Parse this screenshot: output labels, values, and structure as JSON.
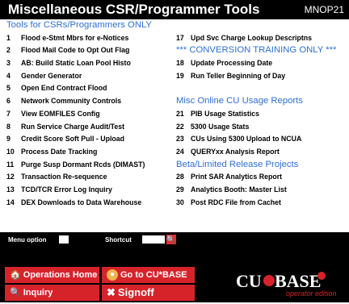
{
  "app": {
    "title": "Miscellaneous CSR/Programmer Tools",
    "code": "MNOP21"
  },
  "left_column": [
    {
      "type": "header",
      "label": "Tools for CSRs/Programmers ONLY"
    },
    {
      "num": "1",
      "label": "Flood e-Stmt Mbrs for e-Notices"
    },
    {
      "num": "2",
      "label": "Flood Mail Code to Opt Out Flag"
    },
    {
      "num": "3",
      "label": "AB: Build Static Loan Pool Histo"
    },
    {
      "num": "4",
      "label": "Gender Generator"
    },
    {
      "num": "5",
      "label": "Open End Contract Flood"
    },
    {
      "num": "6",
      "label": "Network Community Controls"
    },
    {
      "num": "7",
      "label": "View EOMFILES Config"
    },
    {
      "num": "8",
      "label": "Run Service Charge Audit/Test"
    },
    {
      "num": "9",
      "label": "Credit Score Soft Pull - Upload"
    },
    {
      "num": "10",
      "label": "Process Date Tracking"
    },
    {
      "num": "11",
      "label": "Purge Susp Dormant Rcds (DIMAST)"
    },
    {
      "num": "12",
      "label": "Transaction Re-sequence"
    },
    {
      "num": "13",
      "label": "TCD/TCR Error Log Inquiry"
    },
    {
      "num": "14",
      "label": "DEX Downloads to Data Warehouse"
    }
  ],
  "right_column": [
    {
      "type": "blank"
    },
    {
      "num": "17",
      "label": "Upd Svc Charge Lookup Descriptns"
    },
    {
      "type": "header",
      "label": "*** CONVERSION TRAINING ONLY ***"
    },
    {
      "num": "18",
      "label": "Update Processing Date"
    },
    {
      "num": "19",
      "label": "Run Teller Beginning of Day"
    },
    {
      "type": "blank"
    },
    {
      "type": "header",
      "label": "Misc Online CU Usage Reports"
    },
    {
      "num": "21",
      "label": "PIB Usage Statistics"
    },
    {
      "num": "22",
      "label": "5300 Usage Stats"
    },
    {
      "num": "23",
      "label": "CUs Using 5300 Upload to NCUA"
    },
    {
      "num": "24",
      "label": "QUERYxx Analysis Report"
    },
    {
      "type": "header",
      "label": "Beta/Limited Release Projects"
    },
    {
      "num": "28",
      "label": "Print SAR Analytics Report"
    },
    {
      "num": "29",
      "label": "Analytics Booth: Master List"
    },
    {
      "num": "30",
      "label": "Post RDC File from Cachet"
    }
  ],
  "command_bar": {
    "menu_option_label": "Menu option",
    "shortcut_label": "Shortcut"
  },
  "buttons": {
    "operations_home": "Operations Home",
    "go_to_cubase": "Go to CU*BASE",
    "inquiry": "Inquiry",
    "signoff": "Signoff"
  },
  "logo": {
    "brand": "CU*BASE",
    "tagline": "operator edition"
  },
  "colors": {
    "accent_blue": "#2d6fd6",
    "button_red": "#d6232a"
  }
}
